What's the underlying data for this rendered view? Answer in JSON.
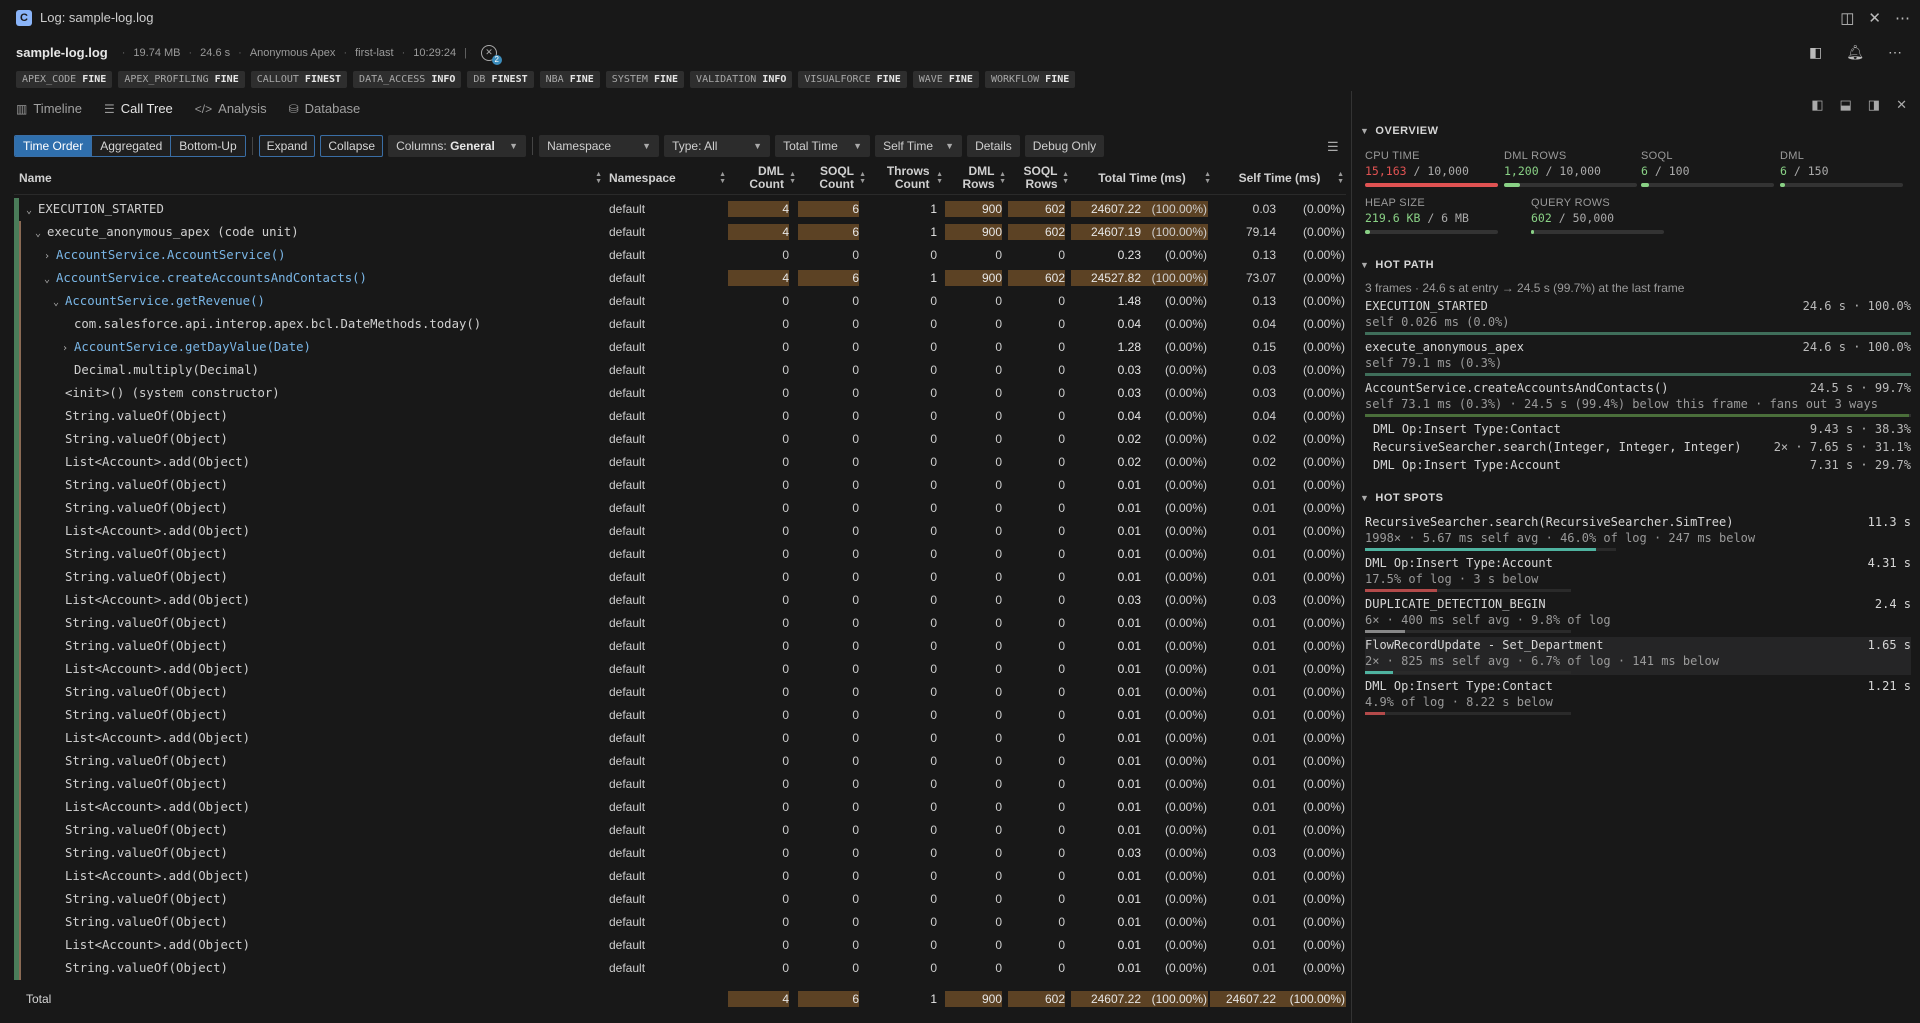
{
  "window": {
    "title": "Log: sample-log.log",
    "app_icon": "C"
  },
  "header": {
    "file_name": "sample-log.log",
    "size": "19.74 MB",
    "duration": "24.6 s",
    "operation": "Anonymous Apex",
    "range": "first-last",
    "time": "10:29:24",
    "error_count": "2"
  },
  "levels": [
    {
      "cat": "APEX_CODE",
      "lvl": "FINE"
    },
    {
      "cat": "APEX_PROFILING",
      "lvl": "FINE"
    },
    {
      "cat": "CALLOUT",
      "lvl": "FINEST"
    },
    {
      "cat": "DATA_ACCESS",
      "lvl": "INFO"
    },
    {
      "cat": "DB",
      "lvl": "FINEST"
    },
    {
      "cat": "NBA",
      "lvl": "FINE"
    },
    {
      "cat": "SYSTEM",
      "lvl": "FINE"
    },
    {
      "cat": "VALIDATION",
      "lvl": "INFO"
    },
    {
      "cat": "VISUALFORCE",
      "lvl": "FINE"
    },
    {
      "cat": "WAVE",
      "lvl": "FINE"
    },
    {
      "cat": "WORKFLOW",
      "lvl": "FINE"
    }
  ],
  "tabs": [
    {
      "label": "Timeline",
      "icon": "chart-bar-icon"
    },
    {
      "label": "Call Tree",
      "icon": "list-tree-icon",
      "active": true
    },
    {
      "label": "Analysis",
      "icon": "code-icon"
    },
    {
      "label": "Database",
      "icon": "database-icon"
    }
  ],
  "toolbar": {
    "modes": [
      "Time Order",
      "Aggregated",
      "Bottom-Up"
    ],
    "active_mode": "Time Order",
    "expand": "Expand",
    "collapse": "Collapse",
    "columns_label": "Columns:",
    "columns_value": "General",
    "namespace": "Namespace",
    "type": "Type: All",
    "total_time": "Total Time",
    "self_time": "Self Time",
    "details": "Details",
    "debug_only": "Debug Only"
  },
  "columns": {
    "name": "Name",
    "namespace": "Namespace",
    "dml_count": "DML Count",
    "soql_count": "SOQL Count",
    "throws_count": "Throws Count",
    "dml_rows": "DML Rows",
    "soql_rows": "SOQL Rows",
    "total_time": "Total Time (ms)",
    "self_time": "Self Time (ms)"
  },
  "rows": [
    {
      "name": "EXECUTION_STARTED",
      "indent": 0,
      "toggle": "open",
      "link": false,
      "ns": "default",
      "dml": "4",
      "soql": "6",
      "throws": "1",
      "dmlrows": "900",
      "soqlrows": "602",
      "total": "24607.22",
      "totalpct": "(100.00%)",
      "self": "0.03",
      "selfpct": "(0.00%)",
      "hl": true
    },
    {
      "name": "execute_anonymous_apex (code unit)",
      "indent": 1,
      "toggle": "open",
      "link": false,
      "ns": "default",
      "dml": "4",
      "soql": "6",
      "throws": "1",
      "dmlrows": "900",
      "soqlrows": "602",
      "total": "24607.19",
      "totalpct": "(100.00%)",
      "self": "79.14",
      "selfpct": "(0.00%)",
      "hl": true
    },
    {
      "name": "AccountService.AccountService()",
      "indent": 2,
      "toggle": "closed",
      "link": true,
      "ns": "default",
      "dml": "0",
      "soql": "0",
      "throws": "0",
      "dmlrows": "0",
      "soqlrows": "0",
      "total": "0.23",
      "totalpct": "(0.00%)",
      "self": "0.13",
      "selfpct": "(0.00%)"
    },
    {
      "name": "AccountService.createAccountsAndContacts()",
      "indent": 2,
      "toggle": "open",
      "link": true,
      "ns": "default",
      "dml": "4",
      "soql": "6",
      "throws": "1",
      "dmlrows": "900",
      "soqlrows": "602",
      "total": "24527.82",
      "totalpct": "(100.00%)",
      "self": "73.07",
      "selfpct": "(0.00%)",
      "hl": true
    },
    {
      "name": "AccountService.getRevenue()",
      "indent": 3,
      "toggle": "open",
      "link": true,
      "ns": "default",
      "dml": "0",
      "soql": "0",
      "throws": "0",
      "dmlrows": "0",
      "soqlrows": "0",
      "total": "1.48",
      "totalpct": "(0.00%)",
      "self": "0.13",
      "selfpct": "(0.00%)"
    },
    {
      "name": "com.salesforce.api.interop.apex.bcl.DateMethods.today()",
      "indent": 4,
      "toggle": "",
      "link": false,
      "ns": "default",
      "dml": "0",
      "soql": "0",
      "throws": "0",
      "dmlrows": "0",
      "soqlrows": "0",
      "total": "0.04",
      "totalpct": "(0.00%)",
      "self": "0.04",
      "selfpct": "(0.00%)"
    },
    {
      "name": "AccountService.getDayValue(Date)",
      "indent": 4,
      "toggle": "closed",
      "link": true,
      "ns": "default",
      "dml": "0",
      "soql": "0",
      "throws": "0",
      "dmlrows": "0",
      "soqlrows": "0",
      "total": "1.28",
      "totalpct": "(0.00%)",
      "self": "0.15",
      "selfpct": "(0.00%)"
    },
    {
      "name": "Decimal.multiply(Decimal)",
      "indent": 4,
      "toggle": "",
      "link": false,
      "ns": "default",
      "dml": "0",
      "soql": "0",
      "throws": "0",
      "dmlrows": "0",
      "soqlrows": "0",
      "total": "0.03",
      "totalpct": "(0.00%)",
      "self": "0.03",
      "selfpct": "(0.00%)"
    },
    {
      "name": "<init>() (system constructor)",
      "indent": 3,
      "toggle": "",
      "link": false,
      "ns": "default",
      "dml": "0",
      "soql": "0",
      "throws": "0",
      "dmlrows": "0",
      "soqlrows": "0",
      "total": "0.03",
      "totalpct": "(0.00%)",
      "self": "0.03",
      "selfpct": "(0.00%)"
    },
    {
      "name": "String.valueOf(Object)",
      "indent": 3,
      "toggle": "",
      "link": false,
      "ns": "default",
      "dml": "0",
      "soql": "0",
      "throws": "0",
      "dmlrows": "0",
      "soqlrows": "0",
      "total": "0.04",
      "totalpct": "(0.00%)",
      "self": "0.04",
      "selfpct": "(0.00%)"
    },
    {
      "name": "String.valueOf(Object)",
      "indent": 3,
      "toggle": "",
      "link": false,
      "ns": "default",
      "dml": "0",
      "soql": "0",
      "throws": "0",
      "dmlrows": "0",
      "soqlrows": "0",
      "total": "0.02",
      "totalpct": "(0.00%)",
      "self": "0.02",
      "selfpct": "(0.00%)"
    },
    {
      "name": "List<Account>.add(Object)",
      "indent": 3,
      "toggle": "",
      "link": false,
      "ns": "default",
      "dml": "0",
      "soql": "0",
      "throws": "0",
      "dmlrows": "0",
      "soqlrows": "0",
      "total": "0.02",
      "totalpct": "(0.00%)",
      "self": "0.02",
      "selfpct": "(0.00%)"
    },
    {
      "name": "String.valueOf(Object)",
      "indent": 3,
      "toggle": "",
      "link": false,
      "ns": "default",
      "dml": "0",
      "soql": "0",
      "throws": "0",
      "dmlrows": "0",
      "soqlrows": "0",
      "total": "0.01",
      "totalpct": "(0.00%)",
      "self": "0.01",
      "selfpct": "(0.00%)"
    },
    {
      "name": "String.valueOf(Object)",
      "indent": 3,
      "toggle": "",
      "link": false,
      "ns": "default",
      "dml": "0",
      "soql": "0",
      "throws": "0",
      "dmlrows": "0",
      "soqlrows": "0",
      "total": "0.01",
      "totalpct": "(0.00%)",
      "self": "0.01",
      "selfpct": "(0.00%)"
    },
    {
      "name": "List<Account>.add(Object)",
      "indent": 3,
      "toggle": "",
      "link": false,
      "ns": "default",
      "dml": "0",
      "soql": "0",
      "throws": "0",
      "dmlrows": "0",
      "soqlrows": "0",
      "total": "0.01",
      "totalpct": "(0.00%)",
      "self": "0.01",
      "selfpct": "(0.00%)"
    },
    {
      "name": "String.valueOf(Object)",
      "indent": 3,
      "toggle": "",
      "link": false,
      "ns": "default",
      "dml": "0",
      "soql": "0",
      "throws": "0",
      "dmlrows": "0",
      "soqlrows": "0",
      "total": "0.01",
      "totalpct": "(0.00%)",
      "self": "0.01",
      "selfpct": "(0.00%)"
    },
    {
      "name": "String.valueOf(Object)",
      "indent": 3,
      "toggle": "",
      "link": false,
      "ns": "default",
      "dml": "0",
      "soql": "0",
      "throws": "0",
      "dmlrows": "0",
      "soqlrows": "0",
      "total": "0.01",
      "totalpct": "(0.00%)",
      "self": "0.01",
      "selfpct": "(0.00%)"
    },
    {
      "name": "List<Account>.add(Object)",
      "indent": 3,
      "toggle": "",
      "link": false,
      "ns": "default",
      "dml": "0",
      "soql": "0",
      "throws": "0",
      "dmlrows": "0",
      "soqlrows": "0",
      "total": "0.03",
      "totalpct": "(0.00%)",
      "self": "0.03",
      "selfpct": "(0.00%)"
    },
    {
      "name": "String.valueOf(Object)",
      "indent": 3,
      "toggle": "",
      "link": false,
      "ns": "default",
      "dml": "0",
      "soql": "0",
      "throws": "0",
      "dmlrows": "0",
      "soqlrows": "0",
      "total": "0.01",
      "totalpct": "(0.00%)",
      "self": "0.01",
      "selfpct": "(0.00%)"
    },
    {
      "name": "String.valueOf(Object)",
      "indent": 3,
      "toggle": "",
      "link": false,
      "ns": "default",
      "dml": "0",
      "soql": "0",
      "throws": "0",
      "dmlrows": "0",
      "soqlrows": "0",
      "total": "0.01",
      "totalpct": "(0.00%)",
      "self": "0.01",
      "selfpct": "(0.00%)"
    },
    {
      "name": "List<Account>.add(Object)",
      "indent": 3,
      "toggle": "",
      "link": false,
      "ns": "default",
      "dml": "0",
      "soql": "0",
      "throws": "0",
      "dmlrows": "0",
      "soqlrows": "0",
      "total": "0.01",
      "totalpct": "(0.00%)",
      "self": "0.01",
      "selfpct": "(0.00%)"
    },
    {
      "name": "String.valueOf(Object)",
      "indent": 3,
      "toggle": "",
      "link": false,
      "ns": "default",
      "dml": "0",
      "soql": "0",
      "throws": "0",
      "dmlrows": "0",
      "soqlrows": "0",
      "total": "0.01",
      "totalpct": "(0.00%)",
      "self": "0.01",
      "selfpct": "(0.00%)"
    },
    {
      "name": "String.valueOf(Object)",
      "indent": 3,
      "toggle": "",
      "link": false,
      "ns": "default",
      "dml": "0",
      "soql": "0",
      "throws": "0",
      "dmlrows": "0",
      "soqlrows": "0",
      "total": "0.01",
      "totalpct": "(0.00%)",
      "self": "0.01",
      "selfpct": "(0.00%)"
    },
    {
      "name": "List<Account>.add(Object)",
      "indent": 3,
      "toggle": "",
      "link": false,
      "ns": "default",
      "dml": "0",
      "soql": "0",
      "throws": "0",
      "dmlrows": "0",
      "soqlrows": "0",
      "total": "0.01",
      "totalpct": "(0.00%)",
      "self": "0.01",
      "selfpct": "(0.00%)"
    },
    {
      "name": "String.valueOf(Object)",
      "indent": 3,
      "toggle": "",
      "link": false,
      "ns": "default",
      "dml": "0",
      "soql": "0",
      "throws": "0",
      "dmlrows": "0",
      "soqlrows": "0",
      "total": "0.01",
      "totalpct": "(0.00%)",
      "self": "0.01",
      "selfpct": "(0.00%)"
    },
    {
      "name": "String.valueOf(Object)",
      "indent": 3,
      "toggle": "",
      "link": false,
      "ns": "default",
      "dml": "0",
      "soql": "0",
      "throws": "0",
      "dmlrows": "0",
      "soqlrows": "0",
      "total": "0.01",
      "totalpct": "(0.00%)",
      "self": "0.01",
      "selfpct": "(0.00%)"
    },
    {
      "name": "List<Account>.add(Object)",
      "indent": 3,
      "toggle": "",
      "link": false,
      "ns": "default",
      "dml": "0",
      "soql": "0",
      "throws": "0",
      "dmlrows": "0",
      "soqlrows": "0",
      "total": "0.01",
      "totalpct": "(0.00%)",
      "self": "0.01",
      "selfpct": "(0.00%)"
    },
    {
      "name": "String.valueOf(Object)",
      "indent": 3,
      "toggle": "",
      "link": false,
      "ns": "default",
      "dml": "0",
      "soql": "0",
      "throws": "0",
      "dmlrows": "0",
      "soqlrows": "0",
      "total": "0.01",
      "totalpct": "(0.00%)",
      "self": "0.01",
      "selfpct": "(0.00%)"
    },
    {
      "name": "String.valueOf(Object)",
      "indent": 3,
      "toggle": "",
      "link": false,
      "ns": "default",
      "dml": "0",
      "soql": "0",
      "throws": "0",
      "dmlrows": "0",
      "soqlrows": "0",
      "total": "0.03",
      "totalpct": "(0.00%)",
      "self": "0.03",
      "selfpct": "(0.00%)"
    },
    {
      "name": "List<Account>.add(Object)",
      "indent": 3,
      "toggle": "",
      "link": false,
      "ns": "default",
      "dml": "0",
      "soql": "0",
      "throws": "0",
      "dmlrows": "0",
      "soqlrows": "0",
      "total": "0.01",
      "totalpct": "(0.00%)",
      "self": "0.01",
      "selfpct": "(0.00%)"
    },
    {
      "name": "String.valueOf(Object)",
      "indent": 3,
      "toggle": "",
      "link": false,
      "ns": "default",
      "dml": "0",
      "soql": "0",
      "throws": "0",
      "dmlrows": "0",
      "soqlrows": "0",
      "total": "0.01",
      "totalpct": "(0.00%)",
      "self": "0.01",
      "selfpct": "(0.00%)"
    },
    {
      "name": "String.valueOf(Object)",
      "indent": 3,
      "toggle": "",
      "link": false,
      "ns": "default",
      "dml": "0",
      "soql": "0",
      "throws": "0",
      "dmlrows": "0",
      "soqlrows": "0",
      "total": "0.01",
      "totalpct": "(0.00%)",
      "self": "0.01",
      "selfpct": "(0.00%)"
    },
    {
      "name": "List<Account>.add(Object)",
      "indent": 3,
      "toggle": "",
      "link": false,
      "ns": "default",
      "dml": "0",
      "soql": "0",
      "throws": "0",
      "dmlrows": "0",
      "soqlrows": "0",
      "total": "0.01",
      "totalpct": "(0.00%)",
      "self": "0.01",
      "selfpct": "(0.00%)"
    },
    {
      "name": "String.valueOf(Object)",
      "indent": 3,
      "toggle": "",
      "link": false,
      "ns": "default",
      "dml": "0",
      "soql": "0",
      "throws": "0",
      "dmlrows": "0",
      "soqlrows": "0",
      "total": "0.01",
      "totalpct": "(0.00%)",
      "self": "0.01",
      "selfpct": "(0.00%)"
    }
  ],
  "total": {
    "label": "Total",
    "dml": "4",
    "soql": "6",
    "throws": "1",
    "dmlrows": "900",
    "soqlrows": "602",
    "total": "24607.22",
    "totalpct": "(100.00%)",
    "self": "24607.22",
    "selfpct": "(100.00%)"
  },
  "overview": {
    "title": "OVERVIEW",
    "metrics": [
      {
        "label": "CPU TIME",
        "used": "15,163",
        "limit": "10,000",
        "fraction": 1.0,
        "color": "#e05252"
      },
      {
        "label": "DML ROWS",
        "used": "1,200",
        "limit": "10,000",
        "fraction": 0.12,
        "color": "#89d185"
      },
      {
        "label": "SOQL",
        "used": "6",
        "limit": "100",
        "fraction": 0.06,
        "color": "#89d185"
      },
      {
        "label": "DML",
        "used": "6",
        "limit": "150",
        "fraction": 0.04,
        "color": "#89d185"
      },
      {
        "label": "HEAP SIZE",
        "used": "219.6 KB",
        "limit": "6 MB",
        "fraction": 0.036,
        "color": "#89d185"
      },
      {
        "label": "QUERY ROWS",
        "used": "602",
        "limit": "50,000",
        "fraction": 0.012,
        "color": "#89d185"
      }
    ]
  },
  "hot_path": {
    "title": "HOT PATH",
    "summary": "3 frames · 24.6 s at entry → 24.5 s (99.7%) at the last frame",
    "frames": [
      {
        "name": "EXECUTION_STARTED",
        "value": "24.6 s · 100.0%",
        "sub": "self 0.026 ms (0.0%)",
        "fraction": 1.0
      },
      {
        "name": "execute_anonymous_apex",
        "value": "24.6 s · 100.0%",
        "sub": "self 79.1 ms (0.3%)",
        "fraction": 1.0
      },
      {
        "name": "AccountService.createAccountsAndContacts()",
        "value": "24.5 s · 99.7%",
        "sub": "self 73.1 ms (0.3%) · 24.5 s (99.4%) below this frame · fans out 3 ways",
        "fraction": 0.997
      }
    ],
    "children": [
      {
        "name": "DML Op:Insert Type:Contact",
        "value": "9.43 s · 38.3%"
      },
      {
        "name": "RecursiveSearcher.search(Integer, Integer, Integer)",
        "mult": "2×",
        "value": "7.65 s · 31.1%"
      },
      {
        "name": "DML Op:Insert Type:Account",
        "value": "7.31 s · 29.7%"
      }
    ]
  },
  "hot_spots": {
    "title": "HOT SPOTS",
    "items": [
      {
        "name": "RecursiveSearcher.search(RecursiveSearcher.SimTree)",
        "value": "11.3 s",
        "sub": "1998× · 5.67 ms self avg · 46.0% of log · 247 ms below",
        "fraction": 0.46,
        "color": "#4fb3a0"
      },
      {
        "name": "DML Op:Insert Type:Account",
        "value": "4.31 s",
        "sub": "17.5% of log · 3 s below",
        "fraction": 0.175,
        "color": "#b34a4a"
      },
      {
        "name": "DUPLICATE_DETECTION_BEGIN",
        "value": "2.4 s",
        "sub": "6× · 400 ms self avg · 9.8% of log",
        "fraction": 0.098,
        "color": "#888888"
      },
      {
        "name": "FlowRecordUpdate - Set_Department",
        "value": "1.65 s",
        "sub": "2× · 825 ms self avg · 6.7% of log · 141 ms below",
        "fraction": 0.067,
        "color": "#4fb3a0",
        "selected": true
      },
      {
        "name": "DML Op:Insert Type:Contact",
        "value": "1.21 s",
        "sub": "4.9% of log · 8.22 s below",
        "fraction": 0.049,
        "color": "#b34a4a"
      }
    ]
  }
}
